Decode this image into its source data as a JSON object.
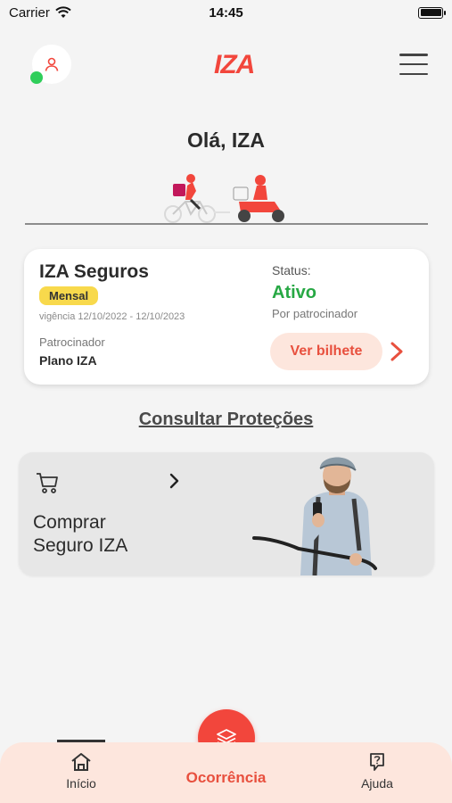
{
  "status_bar": {
    "carrier": "Carrier",
    "time": "14:45"
  },
  "header": {
    "logo": "IZA"
  },
  "greeting": "Olá, IZA",
  "insurance": {
    "title": "IZA Seguros",
    "plan": "Mensal",
    "validity": "vigência 12/10/2022  - 12/10/2023",
    "sponsor_label": "Patrocinador",
    "sponsor_value": "Plano IZA",
    "status_label": "Status:",
    "status_value": "Ativo",
    "status_sub": "Por patrocinador",
    "ticket_button": "Ver bilhete"
  },
  "consult_link": "Consultar Proteções",
  "buy_card": {
    "title": "Comprar Seguro IZA"
  },
  "bottom_nav": {
    "home": "Início",
    "occurrence": "Ocorrência",
    "help": "Ajuda"
  },
  "colors": {
    "brand": "#f2463c",
    "status_active": "#27a844",
    "badge": "#f8d94c",
    "nav_bg": "#fde6dd"
  }
}
